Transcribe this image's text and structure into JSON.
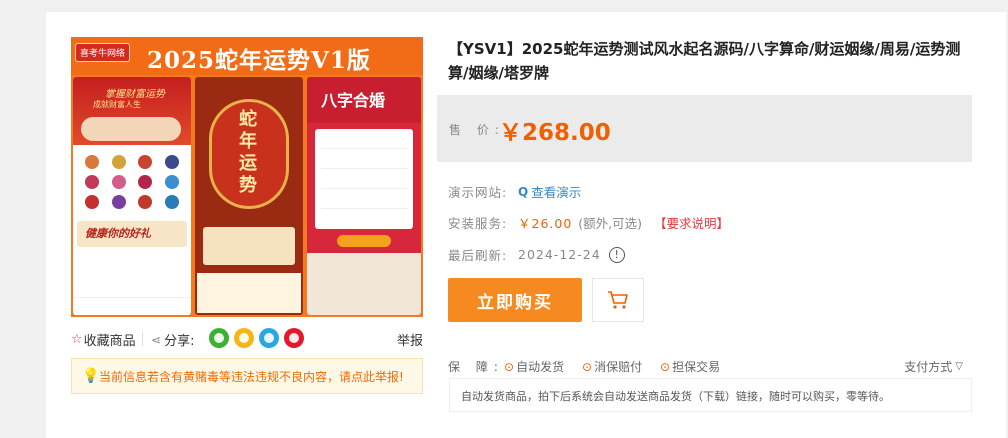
{
  "gallery": {
    "badge": "喜考牛网络",
    "headline": "2025蛇年运势V1版",
    "panel1_title": "掌握财富运势",
    "panel1_subtitle": "成就财富人生",
    "panel1_strip": "健康你的好礼",
    "panel2_text": "蛇年运势",
    "panel3_title": "八字合婚"
  },
  "actions": {
    "favorite_label": "收藏商品",
    "share_label": "分享:",
    "report_label": "举报"
  },
  "notice": {
    "text": "当前信息若含有黄赌毒等违法违规不良内容，请点此举报!"
  },
  "product": {
    "title": "【YSV1】2025蛇年运势测试风水起名源码/八字算命/财运姻缘/周易/运势测算/姻缘/塔罗牌",
    "price_label": "售 价:",
    "price": "￥268.00"
  },
  "details": {
    "demo_label": "演示网站:",
    "demo_link": "查看演示",
    "install_label": "安装服务:",
    "install_price": "￥26.00",
    "install_extra": "(额外,可选)",
    "install_req": "【要求说明】",
    "refresh_label": "最后刷新:",
    "refresh_date": "2024-12-24",
    "info_glyph": "!"
  },
  "buttons": {
    "buy": "立即购买"
  },
  "guarantee": {
    "label": "保 障:",
    "items": [
      "自动发货",
      "消保赔付",
      "担保交易"
    ],
    "payment": "支付方式"
  },
  "description": "自动发货商品，拍下后系统会自动发送商品发货（下载）链接，随时可以购买，零等待。"
}
